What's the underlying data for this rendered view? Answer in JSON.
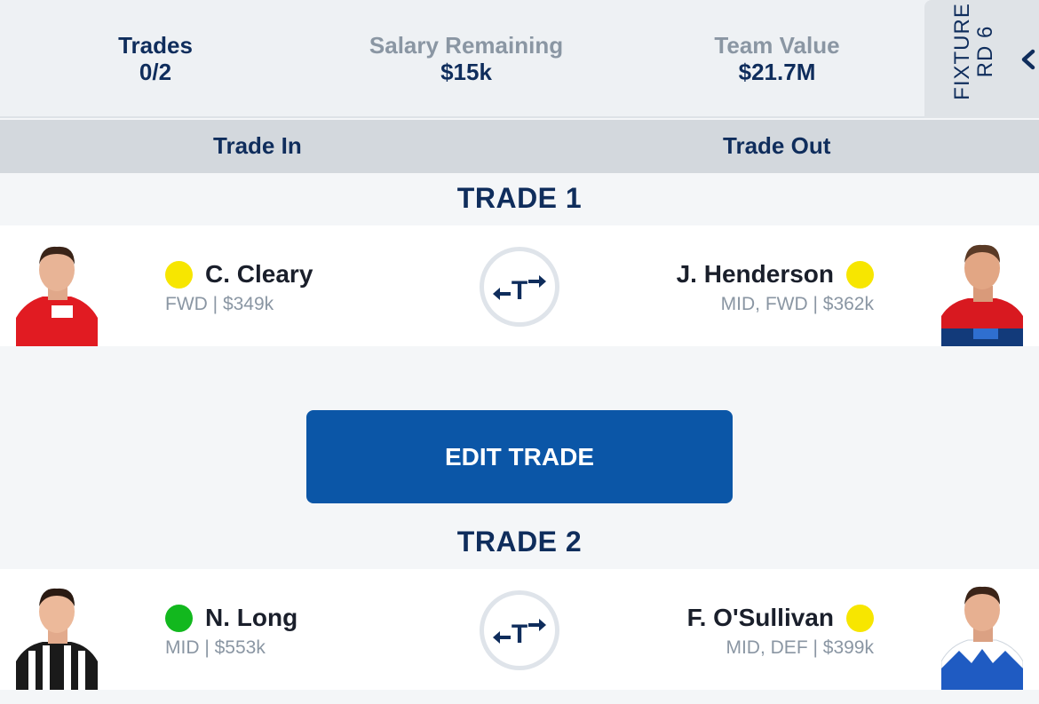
{
  "stats": {
    "trades": {
      "label": "Trades",
      "value": "0/2"
    },
    "salary": {
      "label": "Salary Remaining",
      "value": "$15k"
    },
    "team_value": {
      "label": "Team Value",
      "value": "$21.7M"
    }
  },
  "fixture": {
    "label": "FIXTURE",
    "round": "RD 6"
  },
  "columns": {
    "trade_in": "Trade In",
    "trade_out": "Trade Out"
  },
  "trades": [
    {
      "title": "TRADE 1",
      "in": {
        "name": "C. Cleary",
        "meta": "FWD | $349k",
        "status": "yellow"
      },
      "out": {
        "name": "J. Henderson",
        "meta": "MID, FWD | $362k",
        "status": "yellow"
      }
    },
    {
      "title": "TRADE 2",
      "in": {
        "name": "N. Long",
        "meta": "MID | $553k",
        "status": "green"
      },
      "out": {
        "name": "F. O'Sullivan",
        "meta": "MID, DEF | $399k",
        "status": "yellow"
      }
    }
  ],
  "edit_trade_label": "EDIT TRADE",
  "icons": {
    "swap": "trade-swap-icon",
    "chevron": "chevron-left-icon"
  },
  "colors": {
    "primary": "#0b56a7",
    "navy": "#0f2d5c",
    "status_yellow": "#f7e600",
    "status_green": "#12b81e"
  }
}
